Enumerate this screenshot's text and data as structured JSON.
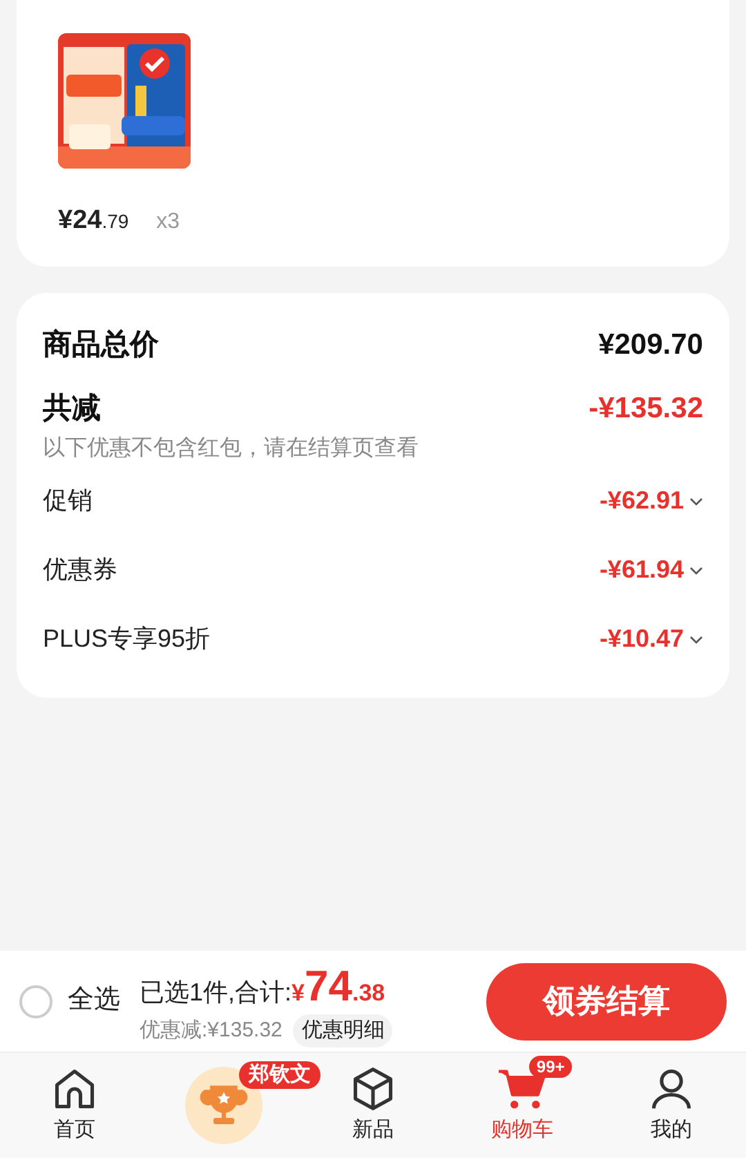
{
  "product": {
    "price_main": "¥24",
    "price_decimal": ".79",
    "quantity": "x3"
  },
  "summary": {
    "total_label": "商品总价",
    "total_value": "¥209.70",
    "reduction_label": "共减",
    "reduction_value": "-¥135.32",
    "note": "以下优惠不包含红包，请在结算页查看",
    "items": [
      {
        "label": "促销",
        "value": "-¥62.91"
      },
      {
        "label": "优惠券",
        "value": "-¥61.94"
      },
      {
        "label": "PLUS专享95折",
        "value": "-¥10.47"
      }
    ]
  },
  "checkout": {
    "select_all": {
      "label": "全选",
      "checked": false
    },
    "selected_text": "已选1件,合计:",
    "currency": "¥",
    "total_main": "74",
    "total_decimal": ".38",
    "discount_text": "优惠减:¥135.32",
    "detail_button": "优惠明细",
    "submit": "领券结算"
  },
  "nav": [
    {
      "kind": "tab",
      "label": "首页",
      "selected": false
    },
    {
      "kind": "promo",
      "badge": "郑钦文"
    },
    {
      "kind": "tab",
      "label": "新品",
      "selected": false
    },
    {
      "kind": "tab",
      "label": "购物车",
      "badge": "99+",
      "selected": true
    },
    {
      "kind": "tab",
      "label": "我的",
      "selected": false
    }
  ]
}
